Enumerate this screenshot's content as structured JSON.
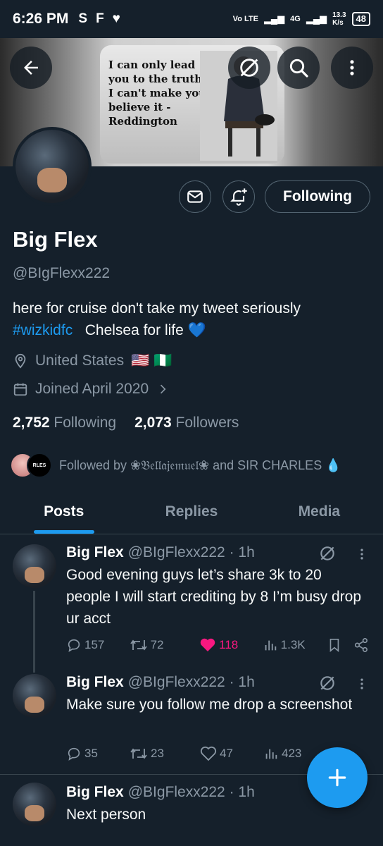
{
  "status_bar": {
    "time": "6:26 PM",
    "left_icons": [
      "S",
      "F",
      "♥"
    ],
    "network": "Vo LTE",
    "network_type": "4G",
    "speed": "13.3",
    "speed_unit": "K/s",
    "battery": "48"
  },
  "banner": {
    "quote": "I can only lead you to the truth. I can't make you believe it - Reddington"
  },
  "profile": {
    "name": "Big Flex",
    "handle": "@BIgFlexx222",
    "bio_text": "here for cruise don't take my tweet seriously",
    "bio_hashtag": "#wizkidfc",
    "bio_tail": "Chelsea for life",
    "bio_heart": "💙",
    "location": "United States",
    "location_flags": "🇺🇸 🇳🇬",
    "joined": "Joined April 2020",
    "following_count": "2,752",
    "following_label": "Following",
    "followers_count": "2,073",
    "followers_label": "Followers",
    "followed_by": "Followed by ❀𝔅𝔢𝔩𝔩𝔞𝔧𝔢𝔪𝔲𝔢𝔩❀ and SIR CHARLES 💧"
  },
  "actions": {
    "following_button": "Following"
  },
  "tabs": [
    {
      "label": "Posts",
      "active": true
    },
    {
      "label": "Replies",
      "active": false
    },
    {
      "label": "Media",
      "active": false
    }
  ],
  "tweets": [
    {
      "name": "Big Flex",
      "meta": "@BIgFlexx222 · 1h",
      "text": "Good evening guys let’s share 3k to 20 people I will start crediting by 8 I’m busy drop ur acct",
      "replies": "157",
      "retweets": "72",
      "likes": "118",
      "views": "1.3K",
      "liked": true
    },
    {
      "name": "Big Flex",
      "meta": "@BIgFlexx222 · 1h",
      "text": "Make sure you follow me drop a screenshot",
      "replies": "35",
      "retweets": "23",
      "likes": "47",
      "views": "423",
      "liked": false
    },
    {
      "name": "Big Flex",
      "meta": "@BIgFlexx222 · 1h",
      "text": "Next person"
    }
  ],
  "colors": {
    "background": "#15202b",
    "accent": "#1d9bf0",
    "muted": "#8b98a5",
    "like": "#f91880",
    "border": "#38444d"
  },
  "icons": [
    "back-arrow-icon",
    "grok-icon",
    "search-icon",
    "more-vertical-icon",
    "mail-icon",
    "bell-plus-icon",
    "location-icon",
    "calendar-icon",
    "chevron-right-icon",
    "reply-icon",
    "retweet-icon",
    "heart-icon",
    "views-icon",
    "bookmark-icon",
    "share-icon",
    "plus-icon"
  ]
}
